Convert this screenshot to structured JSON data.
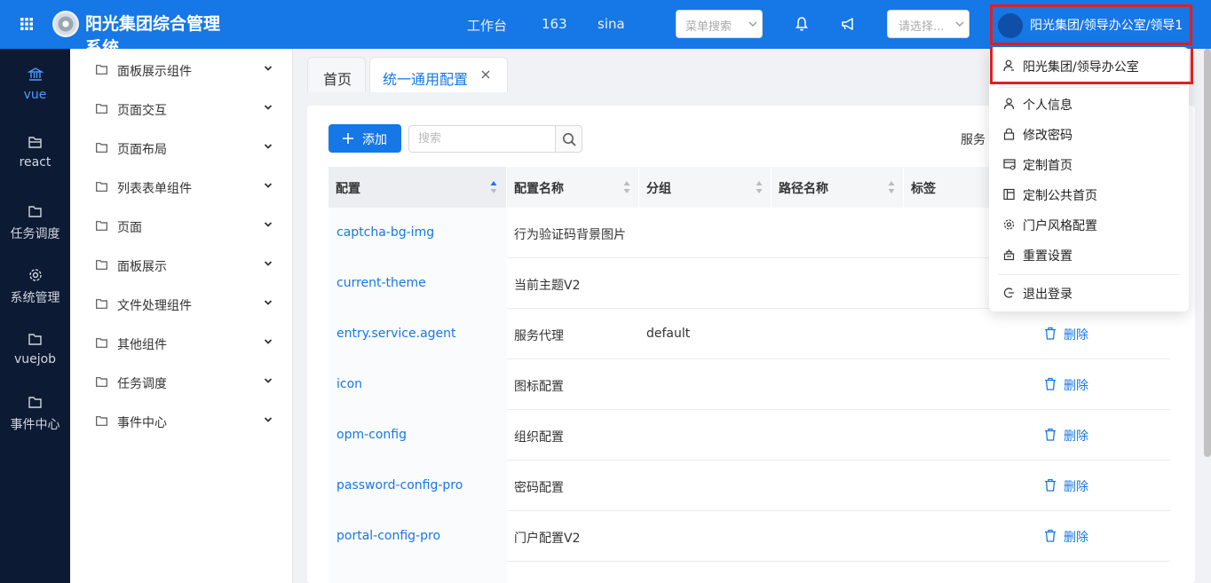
{
  "header": {
    "app_title": "阳光集团综合管理系统",
    "links": [
      "工作台",
      "163",
      "sina"
    ],
    "menu_search_placeholder": "菜单搜索",
    "select_placeholder": "请选择...",
    "user_label": "阳光集团/领导办公室/领导1",
    "brand_color": "#1677e6"
  },
  "leftnav": {
    "items": [
      {
        "label": "vue",
        "icon": "bank-icon",
        "active": true
      },
      {
        "label": "react",
        "icon": "folder-open-icon"
      },
      {
        "label": "任务调度",
        "icon": "folder-icon"
      },
      {
        "label": "系统管理",
        "icon": "gear-icon"
      },
      {
        "label": "vuejob",
        "icon": "folder-icon"
      },
      {
        "label": "事件中心",
        "icon": "folder-icon"
      }
    ]
  },
  "subnav": {
    "items": [
      "面板展示组件",
      "页面交互",
      "页面布局",
      "列表表单组件",
      "页面",
      "面板展示",
      "文件处理组件",
      "其他组件",
      "任务调度",
      "事件中心"
    ]
  },
  "tabs": {
    "home": "首页",
    "active": "统一通用配置"
  },
  "toolbar": {
    "add_label": "添加",
    "search_placeholder": "搜索",
    "service_label": "服务"
  },
  "table": {
    "columns": [
      "配置",
      "配置名称",
      "分组",
      "路径名称",
      "标签"
    ],
    "delete_label": "删除",
    "rows": [
      {
        "key": "captcha-bg-img",
        "name": "行为验证码背景图片",
        "group": "",
        "deletable": false
      },
      {
        "key": "current-theme",
        "name": "当前主题V2",
        "group": "",
        "deletable": false
      },
      {
        "key": "entry.service.agent",
        "name": "服务代理",
        "group": "default",
        "deletable": true
      },
      {
        "key": "icon",
        "name": "图标配置",
        "group": "",
        "deletable": true
      },
      {
        "key": "opm-config",
        "name": "组织配置",
        "group": "",
        "deletable": true
      },
      {
        "key": "password-config-pro",
        "name": "密码配置",
        "group": "",
        "deletable": true
      },
      {
        "key": "portal-config-pro",
        "name": "门户配置V2",
        "group": "",
        "deletable": true
      }
    ]
  },
  "dropdown": {
    "org": "阳光集团/领导办公室",
    "items": [
      {
        "label": "个人信息",
        "icon": "user-icon"
      },
      {
        "label": "修改密码",
        "icon": "lock-icon"
      },
      {
        "label": "定制首页",
        "icon": "home-settings-icon"
      },
      {
        "label": "定制公共首页",
        "icon": "layout-icon"
      },
      {
        "label": "门户风格配置",
        "icon": "gear-icon"
      },
      {
        "label": "重置设置",
        "icon": "reset-icon"
      }
    ],
    "logout": "退出登录"
  }
}
